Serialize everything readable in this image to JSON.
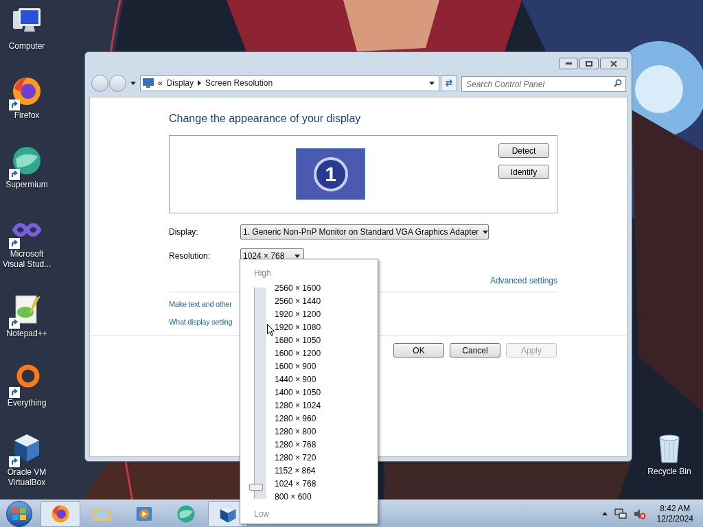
{
  "desktop_icons": [
    {
      "label": "Computer",
      "kind": "computer"
    },
    {
      "label": "Firefox",
      "kind": "fox"
    },
    {
      "label": "Supermium",
      "kind": "leaf"
    },
    {
      "label": "Microsoft Visual Stud...",
      "kind": "infinity"
    },
    {
      "label": "Notepad++",
      "kind": "notepad"
    },
    {
      "label": "Everything",
      "kind": "ring"
    },
    {
      "label": "Oracle VM VirtualBox",
      "kind": "cube"
    }
  ],
  "recycle_bin": {
    "label": "Recycle Bin"
  },
  "window": {
    "breadcrumb_prefix": "«",
    "breadcrumb": [
      "Display",
      "Screen Resolution"
    ],
    "search": {
      "placeholder": "Search Control Panel"
    },
    "heading": "Change the appearance of your display",
    "monitor_number": "1",
    "side_buttons": [
      "Detect",
      "Identify"
    ],
    "display": {
      "label": "Display:",
      "value": "1. Generic Non-PnP Monitor on Standard VGA Graphics Adapter"
    },
    "resolution": {
      "label": "Resolution:",
      "value": "1024 × 768"
    },
    "advanced_link": "Advanced settings",
    "links": [
      "Make text and other",
      "What display setting"
    ],
    "footer_buttons": [
      {
        "label": "OK",
        "disabled": false
      },
      {
        "label": "Cancel",
        "disabled": false
      },
      {
        "label": "Apply",
        "disabled": true
      }
    ]
  },
  "resolution_popup": {
    "high_label": "High",
    "low_label": "Low",
    "options": [
      {
        "label": "2560 × 1600",
        "selected": false
      },
      {
        "label": "2560 × 1440",
        "selected": false
      },
      {
        "label": "1920 × 1200",
        "selected": false
      },
      {
        "label": "1920 × 1080",
        "selected": false
      },
      {
        "label": "1680 × 1050",
        "selected": false
      },
      {
        "label": "1600 × 1200",
        "selected": false
      },
      {
        "label": "1600 × 900",
        "selected": false
      },
      {
        "label": "1440 × 900",
        "selected": false
      },
      {
        "label": "1400 × 1050",
        "selected": false
      },
      {
        "label": "1280 × 1024",
        "selected": false
      },
      {
        "label": "1280 × 960",
        "selected": false
      },
      {
        "label": "1280 × 800",
        "selected": false
      },
      {
        "label": "1280 × 768",
        "selected": false
      },
      {
        "label": "1280 × 720",
        "selected": false
      },
      {
        "label": "1152 × 864",
        "selected": false
      },
      {
        "label": "1024 × 768",
        "selected": true
      },
      {
        "label": "800 × 600",
        "selected": false
      }
    ]
  },
  "taskbar": {
    "apps": [
      {
        "kind": "fox",
        "active": true
      },
      {
        "kind": "folder",
        "active": false
      },
      {
        "kind": "media",
        "active": false
      },
      {
        "kind": "leaf",
        "active": false
      },
      {
        "kind": "cube",
        "active": true
      }
    ],
    "clock": {
      "time": "8:42 AM",
      "date": "12/2/2024"
    }
  }
}
